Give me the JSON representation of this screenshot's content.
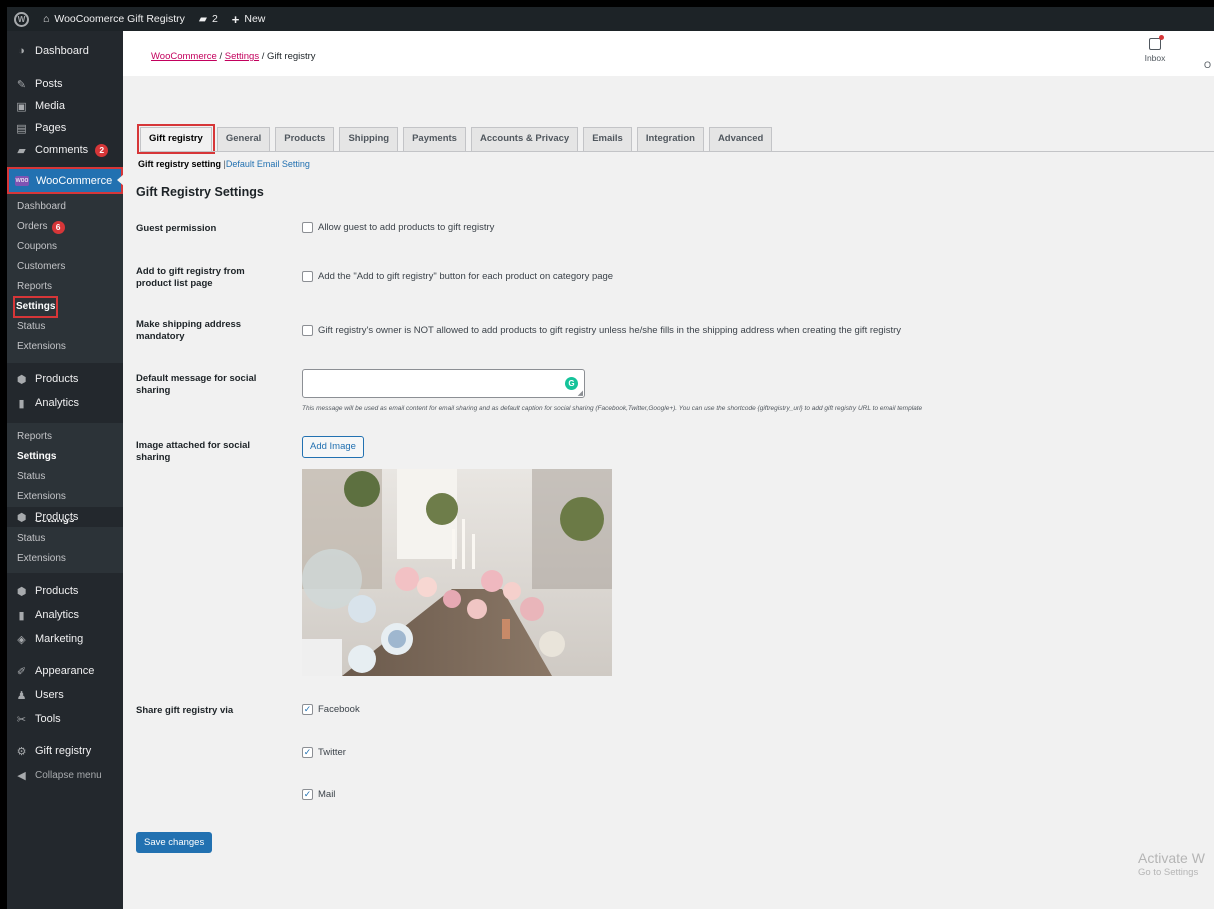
{
  "adminbar": {
    "site_name": "WooCoomerce Gift Registry",
    "comments_count": "2",
    "new_label": "New"
  },
  "sidebar": {
    "top_items": [
      {
        "label": "Dashboard",
        "icon": "dashboard-icon"
      },
      {
        "label": "Posts",
        "icon": "pin-icon"
      },
      {
        "label": "Media",
        "icon": "media-icon"
      },
      {
        "label": "Pages",
        "icon": "pages-icon"
      },
      {
        "label": "Comments",
        "icon": "comment-icon",
        "badge": "2"
      }
    ],
    "woocommerce": {
      "label": "WooCommerce",
      "submenu": [
        {
          "label": "Dashboard"
        },
        {
          "label": "Orders",
          "badge": "6"
        },
        {
          "label": "Coupons"
        },
        {
          "label": "Customers"
        },
        {
          "label": "Reports"
        },
        {
          "label": "Settings"
        },
        {
          "label": "Status"
        },
        {
          "label": "Extensions"
        }
      ]
    },
    "products_label": "Products",
    "analytics_label": "Analytics",
    "ghost_sub1": [
      "Reports",
      "Settings",
      "Status",
      "Extensions"
    ],
    "ghost_products_label": "Products",
    "ghost_settings_fragment": "Settings",
    "ghost_sub2": [
      "Status",
      "Extensions"
    ],
    "bottom_items": [
      {
        "label": "Products",
        "icon": "products-icon"
      },
      {
        "label": "Analytics",
        "icon": "analytics-icon"
      },
      {
        "label": "Marketing",
        "icon": "marketing-icon"
      },
      {
        "label": "Appearance",
        "icon": "appearance-icon"
      },
      {
        "label": "Users",
        "icon": "users-icon"
      },
      {
        "label": "Tools",
        "icon": "tools-icon"
      },
      {
        "label": "Gift registry",
        "icon": "gear-icon"
      },
      {
        "label": "Collapse menu",
        "icon": "collapse-icon"
      }
    ]
  },
  "breadcrumb": {
    "woocommerce": "WooCommerce",
    "sep": "/",
    "settings": "Settings",
    "current": "Gift registry"
  },
  "inbox_label": "Inbox",
  "inbox_cut": "O",
  "tabs": [
    {
      "label": "Gift registry",
      "active": true
    },
    {
      "label": "General"
    },
    {
      "label": "Products"
    },
    {
      "label": "Shipping"
    },
    {
      "label": "Payments"
    },
    {
      "label": "Accounts & Privacy"
    },
    {
      "label": "Emails"
    },
    {
      "label": "Integration"
    },
    {
      "label": "Advanced"
    }
  ],
  "subsub": {
    "current": "Gift registry setting",
    "separator": "|",
    "link": "Default Email Setting"
  },
  "section_title": "Gift Registry Settings",
  "fields": {
    "guest": {
      "label": "Guest permission",
      "text": "Allow guest to add products to gift registry",
      "checked": false
    },
    "addlist": {
      "label": "Add to gift registry from product list page",
      "text": "Add the \"Add to gift registry\" button for each product on category page",
      "checked": false
    },
    "shipping": {
      "label": "Make shipping address mandatory",
      "text": "Gift registry's owner is NOT allowed to add products to gift registry unless he/she fills in the shipping address when creating the gift registry",
      "checked": false
    },
    "message": {
      "label": "Default message for social sharing",
      "value": "",
      "description": "This message will be used as email content for email sharing and as default caption for social sharing (Facebook,Twitter,Google+). You can use the shortcode {giftregistry_url} to add gift registry URL to email template"
    },
    "image": {
      "label": "Image attached for social sharing",
      "button": "Add Image"
    },
    "share": {
      "label": "Share gift registry via",
      "options": [
        {
          "label": "Facebook",
          "checked": true
        },
        {
          "label": "Twitter",
          "checked": true
        },
        {
          "label": "Mail",
          "checked": true
        }
      ]
    }
  },
  "save_button": "Save changes",
  "activate": {
    "line1": "Activate W",
    "line2": "Go to Settings"
  }
}
